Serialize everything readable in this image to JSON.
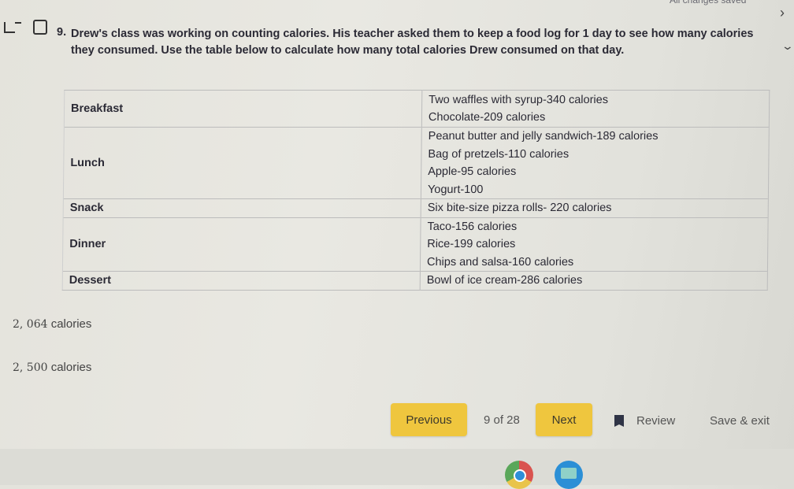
{
  "status": {
    "saved_text": "All changes saved"
  },
  "question": {
    "number": "9.",
    "text": "Drew's class was working on counting calories. His teacher asked them to keep a food log for 1 day to see how many calories they consumed. Use the table below to calculate how many total calories Drew consumed on that day."
  },
  "table": {
    "rows": [
      {
        "meal": "Breakfast",
        "items": [
          "Two waffles with syrup-340 calories",
          "Chocolate-209 calories"
        ]
      },
      {
        "meal": "Lunch",
        "items": [
          "Peanut butter and jelly sandwich-189 calories",
          "Bag of pretzels-110 calories",
          "Apple-95 calories",
          "Yogurt-100"
        ]
      },
      {
        "meal": "Snack",
        "items": [
          "Six bite-size pizza rolls- 220 calories"
        ]
      },
      {
        "meal": "Dinner",
        "items": [
          "Taco-156 calories",
          "Rice-199 calories",
          "Chips and salsa-160 calories"
        ]
      },
      {
        "meal": "Dessert",
        "items": [
          "Bowl of ice cream-286 calories"
        ]
      }
    ]
  },
  "options": [
    {
      "number": "2, 064",
      "unit": "calories"
    },
    {
      "number": "2, 500",
      "unit": "calories"
    }
  ],
  "nav": {
    "previous_label": "Previous",
    "page_indicator": "9 of 28",
    "next_label": "Next",
    "review_label": "Review",
    "save_exit_label": "Save & exit"
  },
  "colors": {
    "button": "#efc63e"
  },
  "shelf": {
    "apps": [
      "chrome-icon",
      "files-icon"
    ]
  }
}
